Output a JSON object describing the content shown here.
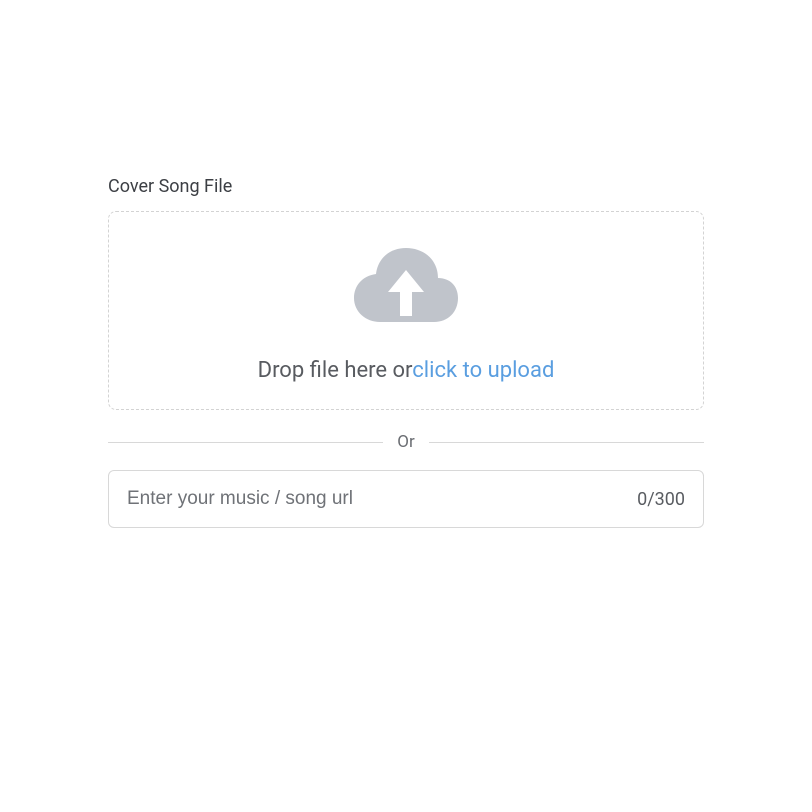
{
  "section": {
    "label": "Cover Song File"
  },
  "dropzone": {
    "text_prefix": "Drop file here or",
    "text_link": "click to upload"
  },
  "divider": {
    "label": "Or"
  },
  "url_input": {
    "placeholder": "Enter your music / song url",
    "value": "",
    "count": "0/300"
  }
}
